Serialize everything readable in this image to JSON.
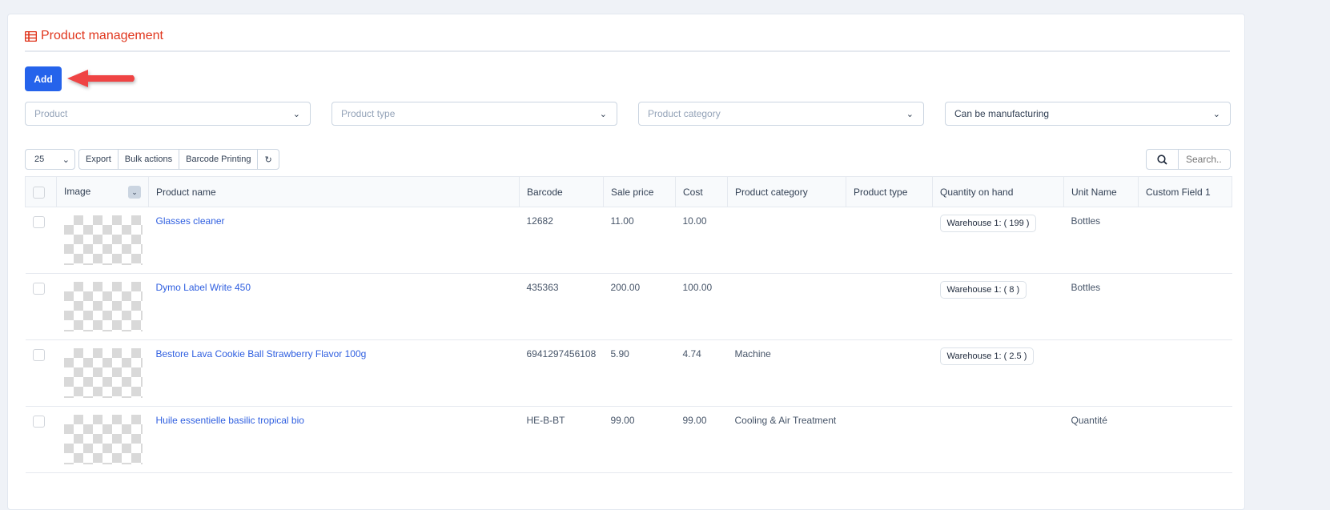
{
  "header": {
    "title": "Product management",
    "icon": "table-list-icon",
    "add_label": "Add"
  },
  "filters": [
    {
      "placeholder": "Product"
    },
    {
      "placeholder": "Product type"
    },
    {
      "placeholder": "Product category"
    },
    {
      "value": "Can be manufacturing"
    }
  ],
  "toolbar": {
    "page_size": "25",
    "export": "Export",
    "bulk": "Bulk actions",
    "barcode": "Barcode Printing",
    "refresh_icon": "refresh-icon",
    "search_placeholder": "Search.."
  },
  "columns": [
    "Image",
    "Product name",
    "Barcode",
    "Sale price",
    "Cost",
    "Product category",
    "Product type",
    "Quantity on hand",
    "Unit Name",
    "Custom Field 1"
  ],
  "rows": [
    {
      "name": "Glasses cleaner",
      "barcode": "12682",
      "sale": "11.00",
      "cost": "10.00",
      "category": "",
      "type": "",
      "qty": "Warehouse 1: ( 199 )",
      "unit": "Bottles",
      "custom": ""
    },
    {
      "name": "Dymo Label Write 450",
      "barcode": "435363",
      "sale": "200.00",
      "cost": "100.00",
      "category": "",
      "type": "",
      "qty": "Warehouse 1: ( 8 )",
      "unit": "Bottles",
      "custom": ""
    },
    {
      "name": "Bestore Lava Cookie Ball Strawberry Flavor 100g",
      "barcode": "6941297456108",
      "sale": "5.90",
      "cost": "4.74",
      "category": "Machine",
      "type": "",
      "qty": "Warehouse 1: ( 2.5 )",
      "unit": "",
      "custom": ""
    },
    {
      "name": "Huile essentielle basilic tropical bio",
      "barcode": "HE-B-BT",
      "sale": "99.00",
      "cost": "99.00",
      "category": "Cooling & Air Treatment",
      "type": "",
      "qty": "",
      "unit": "Quantité",
      "custom": ""
    }
  ],
  "colors": {
    "accent": "#2563eb",
    "title": "#e0361d",
    "link": "#2f5fe0",
    "arrow": "#ef4444"
  }
}
